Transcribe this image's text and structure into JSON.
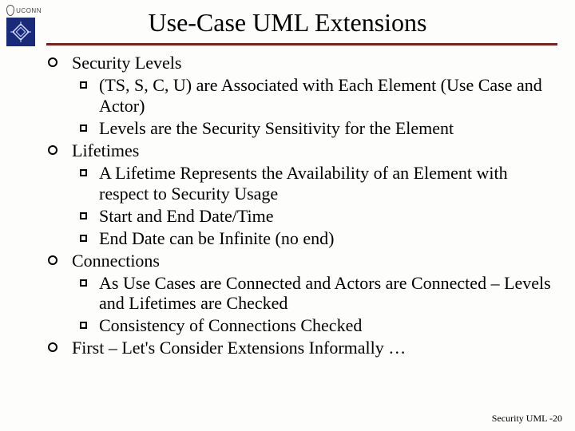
{
  "logo": {
    "text": "UCONN"
  },
  "title": "Use-Case UML Extensions",
  "bullets": [
    {
      "label": "Security Levels",
      "sub": [
        "(TS, S, C, U) are Associated with Each Element (Use Case and Actor)",
        "Levels are the Security Sensitivity for the Element"
      ]
    },
    {
      "label": "Lifetimes",
      "sub": [
        "A Lifetime Represents the Availability of an Element with respect to Security Usage",
        "Start and End Date/Time",
        "End Date can be Infinite (no end)"
      ]
    },
    {
      "label": "Connections",
      "sub": [
        "As Use Cases are Connected and Actors are Connected – Levels and Lifetimes are Checked",
        "Consistency of Connections Checked"
      ]
    },
    {
      "label": "First – Let's Consider Extensions Informally …",
      "sub": []
    }
  ],
  "footer": "Security UML -20"
}
